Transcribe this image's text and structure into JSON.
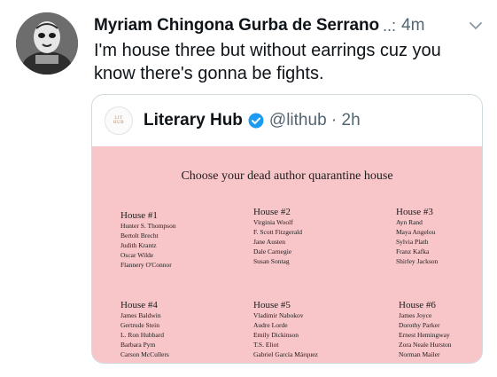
{
  "tweet": {
    "author_name": "Myriam Chingona Gurba de Serrano",
    "ellipsis": "..:",
    "time": "4m",
    "text": "I'm house three but without earrings cuz you know there's gonna be fights.",
    "avatar_icon": "masked-wrestler-avatar",
    "menu_icon": "chevron-down-icon"
  },
  "quote": {
    "logo_line1": "LIT",
    "logo_line2": "HUB",
    "name": "Literary Hub",
    "verified_icon": "verified-badge-icon",
    "handle_time": "@lithub · 2h",
    "image": {
      "title": "Choose your dead author quarantine house",
      "background": "#f8c5c8",
      "houses": [
        {
          "title": "House #1",
          "members": [
            "Hunter S. Thompson",
            "Bertolt Brecht",
            "Judith Krantz",
            "Oscar Wilde",
            "Flannery O'Connor"
          ]
        },
        {
          "title": "House #2",
          "members": [
            "Virginia Woolf",
            "F. Scott Fitzgerald",
            "Jane Austen",
            "Dale Carnegie",
            "Susan Sontag"
          ]
        },
        {
          "title": "House #3",
          "members": [
            "Ayn Rand",
            "Maya Angelou",
            "Sylvia Plath",
            "Franz Kafka",
            "Shirley Jackson"
          ]
        },
        {
          "title": "House #4",
          "members": [
            "James Baldwin",
            "Gertrude Stein",
            "L. Ron Hubbard",
            "Barbara Pym",
            "Carson McCullers"
          ]
        },
        {
          "title": "House #5",
          "members": [
            "Vladimir Nabokov",
            "Audre Lorde",
            "Emily Dickinson",
            "T.S. Eliot",
            "Gabriel García Márquez"
          ]
        },
        {
          "title": "House #6",
          "members": [
            "James Joyce",
            "Dorothy Parker",
            "Ernest Hemingway",
            "Zora Neale Hurston",
            "Norman Mailer"
          ]
        }
      ]
    }
  },
  "colors": {
    "text": "#0f1419",
    "secondary": "#536471",
    "verified": "#1d9bf0",
    "card_border": "#cfd9de"
  }
}
